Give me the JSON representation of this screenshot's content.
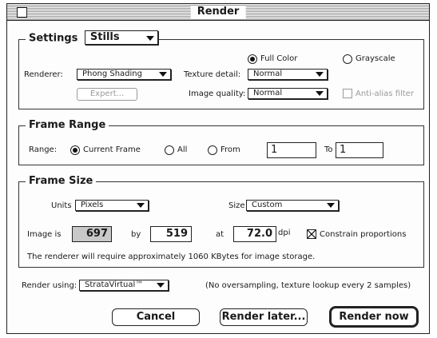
{
  "window": {
    "title": "Render"
  },
  "settings": {
    "legend": "Settings",
    "mode_popup": "Stills",
    "color_full": "Full Color",
    "color_gray": "Grayscale",
    "renderer_label": "Renderer:",
    "renderer_value": "Phong Shading",
    "texture_label": "Texture detail:",
    "texture_value": "Normal",
    "expert_label": "Expert...",
    "quality_label": "Image quality:",
    "quality_value": "Normal",
    "antialias_label": "Anti-alias filter"
  },
  "frame_range": {
    "legend": "Frame Range",
    "range_label": "Range:",
    "current_frame": "Current Frame",
    "all": "All",
    "from": "From",
    "from_value": "1",
    "to": "To",
    "to_value": "1"
  },
  "frame_size": {
    "legend": "Frame Size",
    "units_label": "Units",
    "units_value": "Pixels",
    "size_label": "Size",
    "size_value": "Custom",
    "image_is_label": "Image is",
    "width": "697",
    "by_label": "by",
    "height": "519",
    "at_label": "at",
    "dpi_value": "72.0",
    "dpi_label": "dpi",
    "constrain_label": "Constrain proportions",
    "memory_note": "The renderer will require approximately 1060 KBytes for image storage."
  },
  "render_using": {
    "label": "Render using:",
    "value": "StrataVirtual™",
    "note": "(No oversampling, texture lookup every 2 samples)"
  },
  "buttons": {
    "cancel": "Cancel",
    "render_later": "Render later...",
    "render_now": "Render now"
  }
}
